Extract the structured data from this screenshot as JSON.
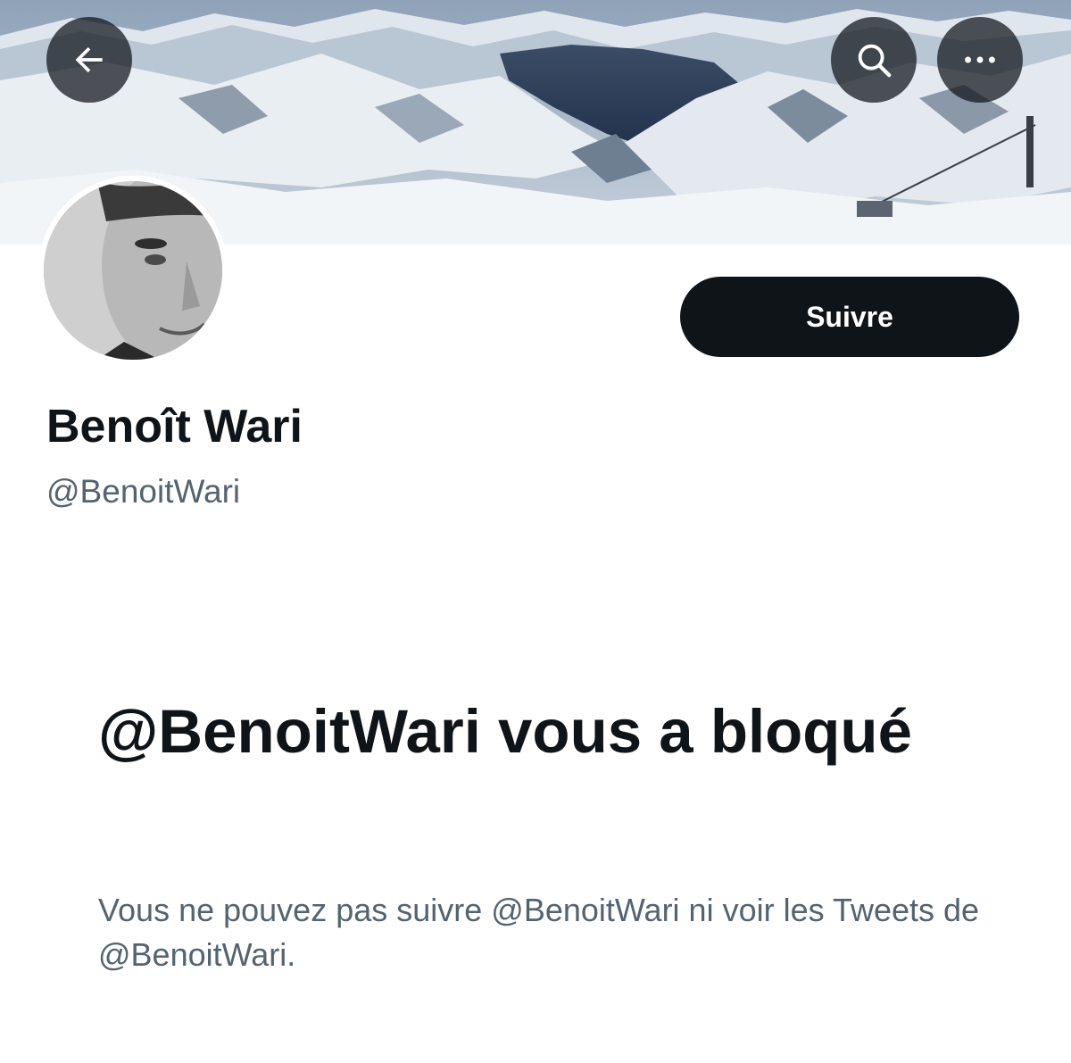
{
  "profile": {
    "display_name": "Benoît Wari",
    "handle": "@BenoitWari",
    "banner_image": "snowy-mountains-landscape",
    "avatar_image": "grayscale-portrait-man"
  },
  "actions": {
    "follow_label": "Suivre",
    "back_icon": "arrow-left-icon",
    "search_icon": "search-icon",
    "more_icon": "more-horizontal-icon"
  },
  "blocked": {
    "title": "@BenoitWari vous a bloqué",
    "description": "Vous ne pouvez pas suivre @BenoitWari ni voir les Tweets de @BenoitWari."
  },
  "colors": {
    "primary_text": "#0f1419",
    "secondary_text": "#536471",
    "button_bg": "#0f1419",
    "button_text": "#ffffff",
    "overlay_button": "#0f1419"
  }
}
